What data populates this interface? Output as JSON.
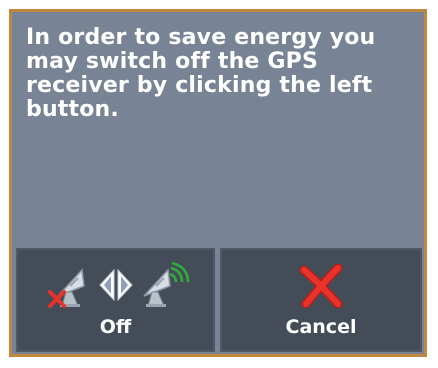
{
  "dialog": {
    "message": "In order to save energy you may switch off the GPS receiver by clicking the left button."
  },
  "buttons": {
    "off": {
      "label": "Off",
      "icons": [
        "gps-off-icon",
        "toggle-arrows-icon",
        "gps-on-icon"
      ]
    },
    "cancel": {
      "label": "Cancel",
      "icon": "red-x-icon"
    }
  },
  "colors": {
    "dialog_background": "#788495",
    "dialog_border": "#c0883e",
    "button_background": "#444c58",
    "cancel_x": "#e8322a",
    "signal_green": "#2fae3a"
  }
}
